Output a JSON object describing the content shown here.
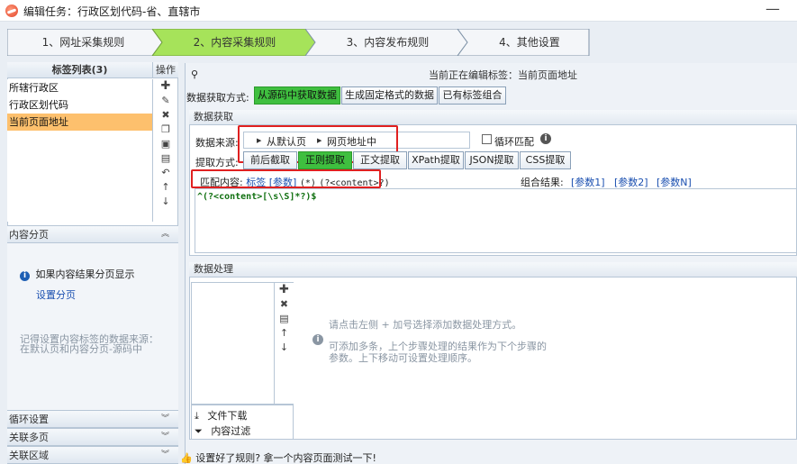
{
  "window": {
    "title": "编辑任务：行政区划代码-省、直辖市",
    "minimize": "—"
  },
  "steps": [
    {
      "label": "1、网址采集规则",
      "active": false
    },
    {
      "label": "2、内容采集规则",
      "active": true
    },
    {
      "label": "3、内容发布规则",
      "active": false
    },
    {
      "label": "4、其他设置",
      "active": false
    }
  ],
  "left": {
    "tag_list_title": "标签列表(3)",
    "ops_title": "操作",
    "tags": [
      "所辖行政区",
      "行政区划代码",
      "当前页面地址"
    ],
    "selected_index": 2,
    "op_icons": [
      "plus-icon",
      "edit-icon",
      "delete-icon",
      "copy-icon",
      "paste-icon",
      "trash-icon",
      "undo-icon",
      "move-up-icon",
      "move-down-icon"
    ],
    "pagination_header": "内容分页",
    "pagination_hint": "如果内容结果分页显示",
    "pagination_link": "设置分页",
    "pagination_note_1": "记得设置内容标签的数据来源：",
    "pagination_note_2": "在默认页和内容分页-源码中",
    "loop_settings": "循环设置",
    "related_pages": "关联多页",
    "related_area": "关联区域"
  },
  "main": {
    "current_tag": "当前正在编辑标签：当前页面地址",
    "fetch_mode_label": "数据获取方式:",
    "fetch_modes": [
      "从源码中获取数据",
      "生成固定格式的数据",
      "已有标签组合"
    ],
    "fetch_mode_active": 0,
    "data_fetch_title": "数据获取",
    "source_label": "数据来源:",
    "source_path": [
      "从默认页",
      "网页地址中"
    ],
    "loop_match": "循环匹配",
    "extract_label": "提取方式:",
    "extract_modes": [
      "前后截取",
      "正则提取",
      "正文提取",
      "XPath提取",
      "JSON提取",
      "CSS提取"
    ],
    "extract_active": 1,
    "match_label": "匹配内容:",
    "match_tag": "标签",
    "match_param": "[参数]",
    "match_wild": "(*)",
    "match_content": "(?<content>?)",
    "combine_label": "组合结果:",
    "combine_params": [
      "[参数1]",
      "[参数2]",
      "[参数N]"
    ],
    "regex": "^(?<content>[\\s\\S]*?)$",
    "processing_title": "数据处理",
    "processing_hint_1": "请点击左侧 + 加号选择添加数据处理方式。",
    "processing_hint_2": "可添加多条，上个步骤处理的结果作为下个步骤的",
    "processing_hint_3": "参数。上下移动可设置处理顺序。",
    "file_download": "文件下载",
    "content_filter": "内容过滤",
    "test_hint": "设置好了规则? 拿一个内容页面测试一下!"
  }
}
